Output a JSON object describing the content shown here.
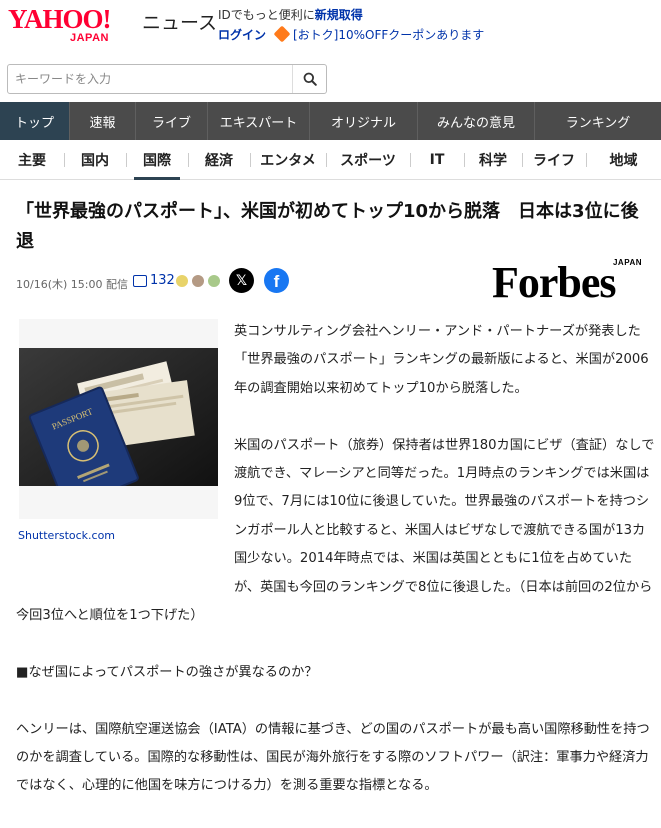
{
  "header": {
    "logo_main": "YAHOO!",
    "logo_sub": "JAPAN",
    "site_name": "ニュース",
    "promo_prefix": "IDでもっと便利に",
    "promo_link": "新規取得",
    "login_label": "ログイン",
    "coupon_text": "[おトク]10%OFFクーポンあります"
  },
  "search": {
    "placeholder": "キーワードを入力",
    "button_icon": "search-icon"
  },
  "main_nav": {
    "items": [
      "トップ",
      "速報",
      "ライブ",
      "エキスパート",
      "オリジナル",
      "みんなの意見",
      "ランキング"
    ],
    "active_index": 0
  },
  "sub_nav": {
    "items": [
      "主要",
      "国内",
      "国際",
      "経済",
      "エンタメ",
      "スポーツ",
      "IT",
      "科学",
      "ライフ",
      "地域"
    ],
    "active_index": 2
  },
  "article": {
    "title": "「世界最強のパスポート」、米国が初めてトップ10から脱落　日本は3位に後退",
    "meta": "10/16(木) 15:00 配信",
    "comment_count": "132",
    "source_logo": "Forbes",
    "source_logo_sub": "JAPAN",
    "image_credit": "Shutterstock.com",
    "paragraphs": [
      "英コンサルティング会社ヘンリー・アンド・パートナーズが発表した「世界最強のパスポート」ランキングの最新版によると、米国が2006年の調査開始以来初めてトップ10から脱落した。",
      "米国のパスポート（旅券）保持者は世界180カ国にビザ（査証）なしで渡航でき、マレーシアと同等だった。1月時点のランキングでは米国は9位で、7月には10位に後退していた。世界最強のパスポートを持つシンガポール人と比較すると、米国人はビザなしで渡航できる国が13カ国少ない。2014年時点では、米国は英国とともに1位を占めていたが、英国も今回のランキングで8位に後退した。（日本は前回の2位から今回3位へと順位を1つ下げた）",
      "■なぜ国によってパスポートの強さが異なるのか？",
      "ヘンリーは、国際航空運送協会（IATA）の情報に基づき、どの国のパスポートが最も高い国際移動性を持つのかを調査している。国際的な移動性は、国民が海外旅行をする際のソフトパワー（訳注：軍事力や経済力ではなく、心理的に他国を味方につける力）を測る重要な指標となる。"
    ]
  },
  "colors": {
    "brand_red": "#ff0033",
    "link_blue": "#0033aa",
    "nav_bg": "#4b4b4b",
    "nav_active": "#2d4352",
    "facebook_blue": "#1877f2"
  }
}
